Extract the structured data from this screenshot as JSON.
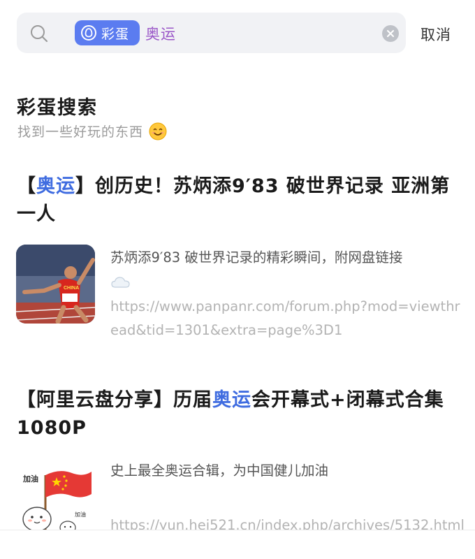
{
  "search": {
    "tag_label": "彩蛋",
    "query": "奥运",
    "cancel_label": "取消"
  },
  "section": {
    "title": "彩蛋搜索",
    "subtitle": "找到一些好玩的东西"
  },
  "results": [
    {
      "title_prefix": "【",
      "title_highlight": "奥运",
      "title_rest": "】创历史！苏炳添9′83 破世界记录 亚洲第一人",
      "description": "苏炳添9′83 破世界记录的精彩瞬间，附网盘链接",
      "url": "https://www.panpanr.com/forum.php?mod=viewthread&tid=1301&extra=page%3D1",
      "thumbnail_text": "CHINA"
    },
    {
      "title_prefix": "【阿里云盘分享】历届",
      "title_highlight": "奥运",
      "title_rest": "会开幕式+闭幕式合集 1080P",
      "description": "史上最全奥运合辑，为中国健儿加油",
      "url": "https://yun.hei521.cn/index.php/archives/5132.html",
      "thumbnail_text_1": "加油",
      "thumbnail_text_2": "加油"
    }
  ],
  "colors": {
    "accent": "#5b7cf0",
    "highlight": "#3f6ce0",
    "query": "#9a57c8"
  }
}
